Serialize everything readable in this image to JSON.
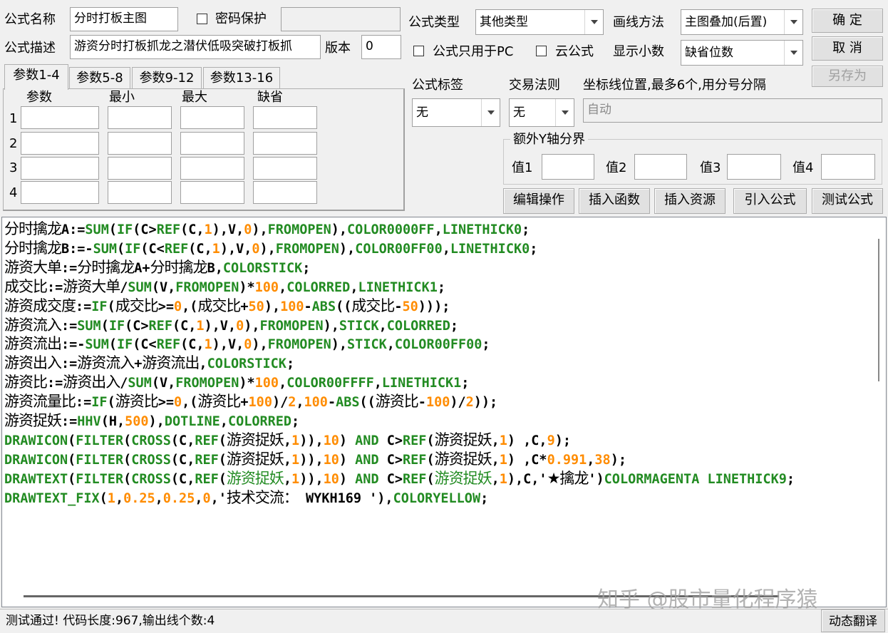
{
  "form": {
    "name_label": "公式名称",
    "name_value": "分时打板主图",
    "password_label": "密码保护",
    "desc_label": "公式描述",
    "desc_value": "游资分时打板抓龙之潜伏低吸突破打板抓",
    "version_label": "版本",
    "version_value": "0",
    "type_label": "公式类型",
    "type_value": "其他类型",
    "draw_label": "画线方法",
    "draw_value": "主图叠加(后置)",
    "pc_only_label": "公式只用于PC",
    "cloud_label": "云公式",
    "decimal_label": "显示小数",
    "decimal_value": "缺省位数",
    "tag_label": "公式标签",
    "tag_value": "无",
    "rule_label": "交易法则",
    "rule_value": "无",
    "coord_label": "坐标线位置,最多6个,用分号分隔",
    "coord_placeholder": "自动",
    "yaxis_label": "额外Y轴分界",
    "y_values": [
      "值1",
      "值2",
      "值3",
      "值4"
    ]
  },
  "buttons": {
    "ok": "确  定",
    "cancel": "取  消",
    "save_as": "另存为",
    "edit_ops": "编辑操作",
    "insert_func": "插入函数",
    "insert_res": "插入资源",
    "import_formula": "引入公式",
    "test_formula": "测试公式",
    "dynamic_translate": "动态翻译"
  },
  "param_tabs": [
    "参数1-4",
    "参数5-8",
    "参数9-12",
    "参数13-16"
  ],
  "param_headers": [
    "参数",
    "最小",
    "最大",
    "缺省"
  ],
  "param_rows": [
    "1",
    "2",
    "3",
    "4"
  ],
  "code_lines": [
    "分时擒龙A:=SUM(IF(C>REF(C,1),V,0),FROMOPEN),COLOR0000FF,LINETHICK0;",
    "分时擒龙B:=-SUM(IF(C<REF(C,1),V,0),FROMOPEN),COLOR00FF00,LINETHICK0;",
    "游资大单:=分时擒龙A+分时擒龙B,COLORSTICK;",
    "成交比:=游资大单/SUM(V,FROMOPEN)*100,COLORRED,LINETHICK1;",
    "游资成交度:=IF(成交比>=0,(成交比+50),100-ABS((成交比-50)));",
    "游资流入:=SUM(IF(C>REF(C,1),V,0),FROMOPEN),STICK,COLORRED;",
    "游资流出:=-SUM(IF(C<REF(C,1),V,0),FROMOPEN),STICK,COLOR00FF00;",
    "游资出入:=游资流入+游资流出,COLORSTICK;",
    "游资比:=游资出入/SUM(V,FROMOPEN)*100,COLOR00FFFF,LINETHICK1;",
    "游资流量比:=IF(游资比>=0,(游资比+100)/2,100-ABS((游资比-100)/2));",
    "游资捉妖:=HHV(H,500),DOTLINE,COLORRED;",
    "DRAWICON(FILTER(CROSS(C,REF(游资捉妖,1)),10) AND C>REF(游资捉妖,1) ,C,9);",
    "DRAWICON(FILTER(CROSS(C,REF(游资捉妖,1)),10) AND C>REF(游资捉妖,1) ,C*0.991,38);",
    "DRAWTEXT(FILTER(CROSS(C,REF(游资捉妖,1)),10) AND C>REF(游资捉妖,1),C,'★擒龙')COLORMAGENTA LINETHICK9;",
    "DRAWTEXT_FIX(1,0.25,0.25,0,'技术交流： WYKH169 '),COLORYELLOW;"
  ],
  "status_text": "测试通过! 代码长度:967,输出线个数:4",
  "watermark": "知乎 @股市量化程序猿",
  "colors": {
    "keyword": "#228b22",
    "number": "#ff8c00",
    "window_bg": "#f0f0f0"
  }
}
